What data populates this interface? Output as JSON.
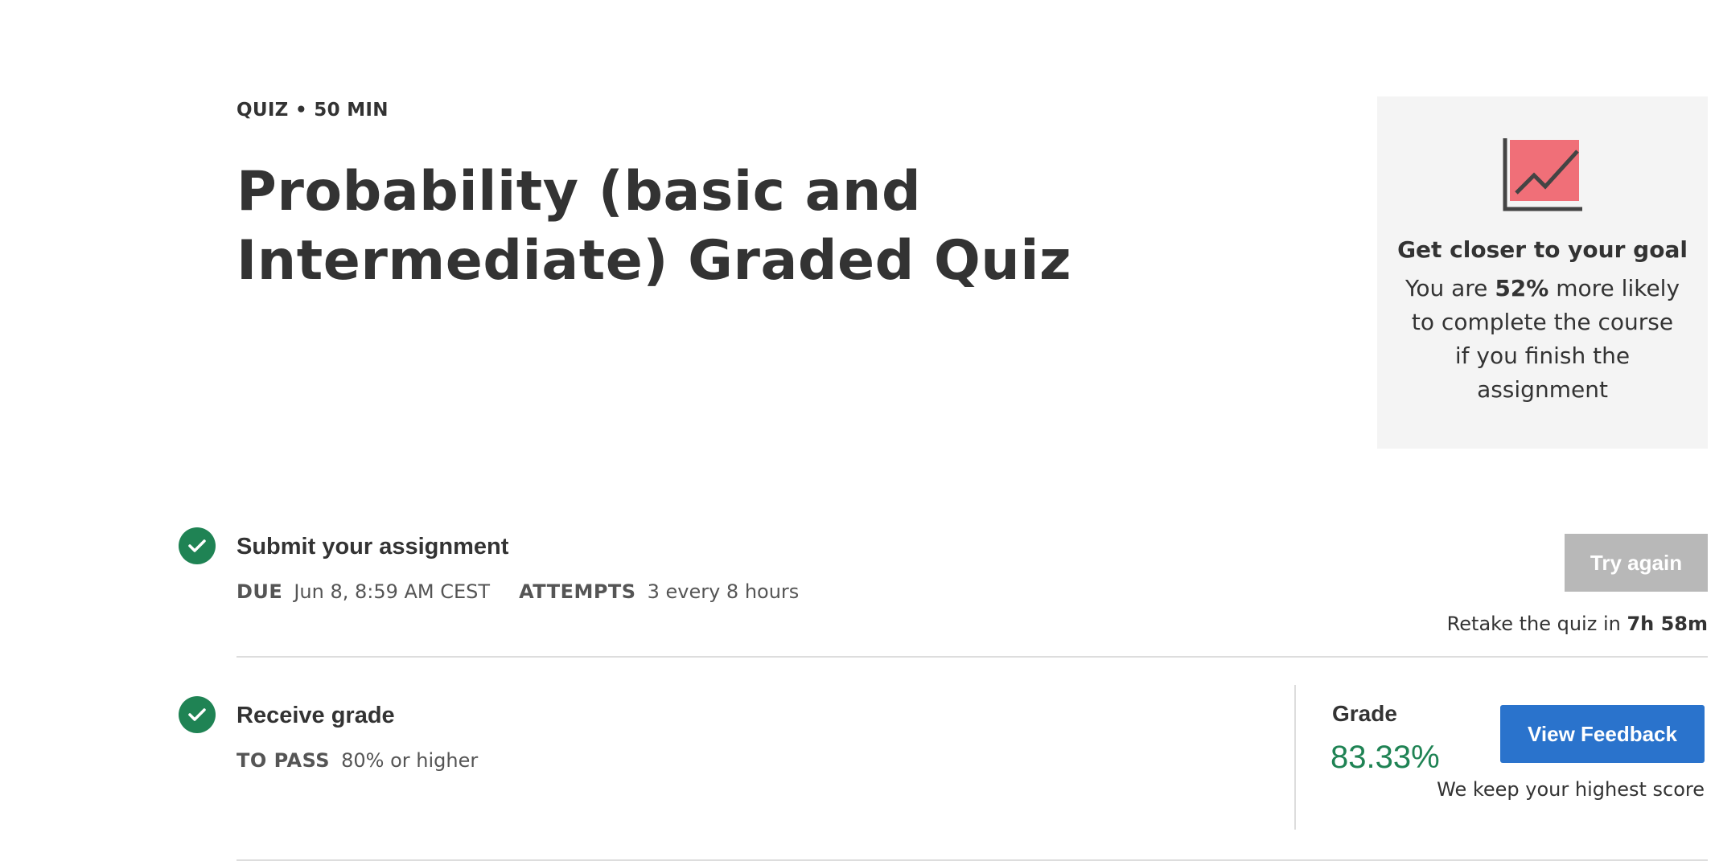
{
  "header": {
    "meta": "QUIZ • 50 MIN",
    "title": "Probability (basic and Intermediate) Graded Quiz"
  },
  "goal_card": {
    "icon": "chart-trend-icon",
    "title": "Get closer to your goal",
    "text_before": "You are ",
    "percent": "52%",
    "text_after": " more likely to complete the course if you finish the assignment"
  },
  "submit_step": {
    "title": "Submit your assignment",
    "due_label": "DUE",
    "due_value": "Jun 8, 8:59 AM CEST",
    "attempts_label": "ATTEMPTS",
    "attempts_value": "3 every 8 hours",
    "try_again_label": "Try again",
    "retake_text": "Retake the quiz in ",
    "retake_time": "7h 58m"
  },
  "grade_step": {
    "title": "Receive grade",
    "to_pass_label": "TO PASS",
    "to_pass_value": "80% or higher",
    "grade_label": "Grade",
    "grade_value": "83.33%",
    "view_feedback_label": "View Feedback",
    "highest_score_note": "We keep your highest score"
  },
  "colors": {
    "success_green": "#1f8354",
    "primary_blue": "#2a73cc",
    "disabled_gray": "#b8b8b8",
    "icon_pink": "#f06f78"
  }
}
